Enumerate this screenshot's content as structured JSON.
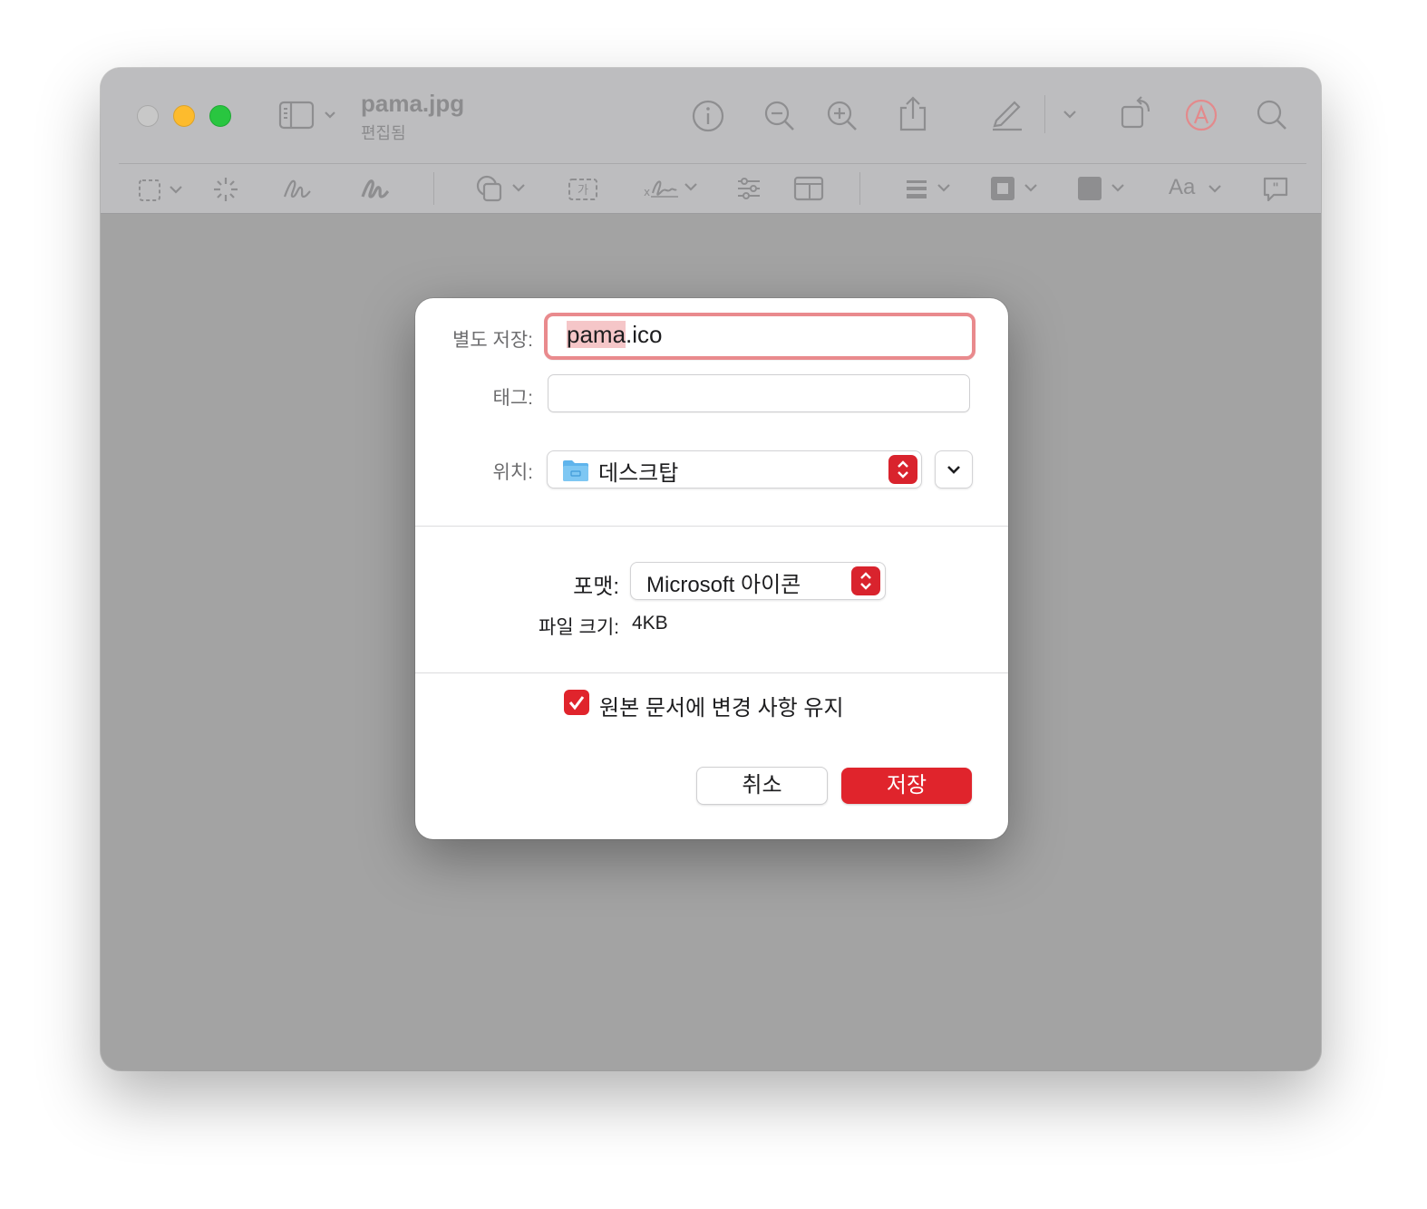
{
  "window": {
    "title": "pama.jpg",
    "subtitle": "편집됨",
    "markup_font_label": "Aa"
  },
  "dialog": {
    "save_as_label": "별도 저장:",
    "filename_selected": "pama",
    "filename_extension": ".ico",
    "tags_label": "태그:",
    "tags_value": "",
    "location_label": "위치:",
    "location_value": "데스크탑",
    "format_label": "포맷:",
    "format_value": "Microsoft 아이콘",
    "file_size_label": "파일 크기:",
    "file_size_value": "4KB",
    "keep_changes_label": "원본 문서에 변경 사항 유지",
    "keep_changes_checked": true,
    "cancel_label": "취소",
    "save_label": "저장"
  },
  "colors": {
    "accent": "#e0242c",
    "focus_ring": "#e98a8d",
    "selection": "#f5c6c8"
  }
}
